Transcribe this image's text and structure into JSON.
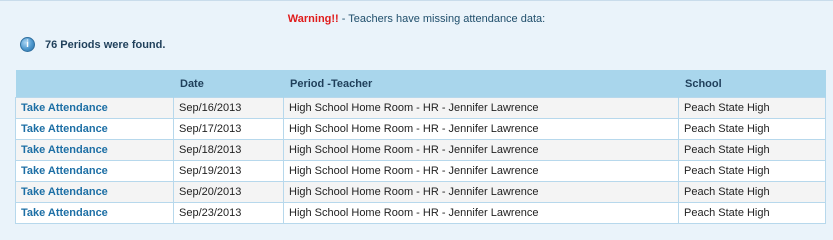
{
  "warning": {
    "label": "Warning!!",
    "text": " - Teachers have missing attendance data:"
  },
  "found": {
    "icon": "info-icon",
    "text": "76 Periods were found."
  },
  "table": {
    "headers": [
      "",
      "Date",
      "Period -Teacher",
      "School"
    ],
    "rows": [
      {
        "action": "Take Attendance",
        "date": "Sep/16/2013",
        "period_teacher": "High School Home Room - HR - Jennifer Lawrence",
        "school": "Peach State High"
      },
      {
        "action": "Take Attendance",
        "date": "Sep/17/2013",
        "period_teacher": "High School Home Room - HR - Jennifer Lawrence",
        "school": "Peach State High"
      },
      {
        "action": "Take Attendance",
        "date": "Sep/18/2013",
        "period_teacher": "High School Home Room - HR - Jennifer Lawrence",
        "school": "Peach State High"
      },
      {
        "action": "Take Attendance",
        "date": "Sep/19/2013",
        "period_teacher": "High School Home Room - HR - Jennifer Lawrence",
        "school": "Peach State High"
      },
      {
        "action": "Take Attendance",
        "date": "Sep/20/2013",
        "period_teacher": "High School Home Room - HR - Jennifer Lawrence",
        "school": "Peach State High"
      },
      {
        "action": "Take Attendance",
        "date": "Sep/23/2013",
        "period_teacher": "High School Home Room - HR - Jennifer Lawrence",
        "school": "Peach State High"
      }
    ]
  }
}
